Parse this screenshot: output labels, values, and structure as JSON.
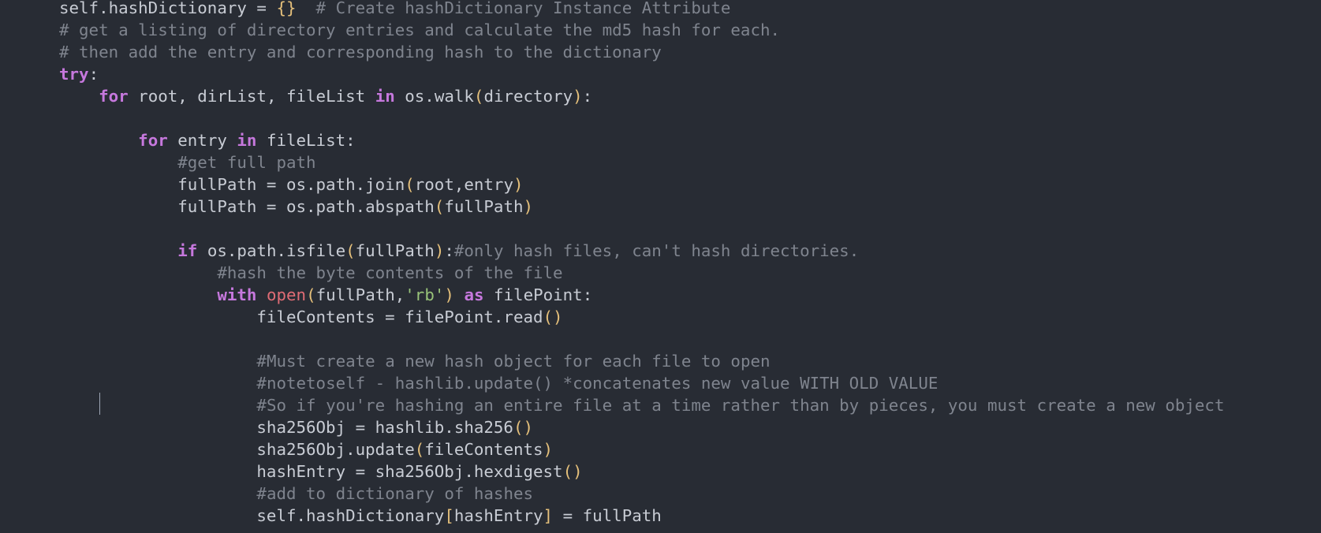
{
  "editor": {
    "lines": [
      [
        {
          "t": "self.hashDictionary = ",
          "c": "tx"
        },
        {
          "t": "{}",
          "c": "br"
        },
        {
          "t": "  # Create hashDictionary Instance Attribute",
          "c": "cm"
        }
      ],
      [
        {
          "t": "# get a listing of directory entries and calculate the md5 hash for each.",
          "c": "cm"
        }
      ],
      [
        {
          "t": "# then add the entry and corresponding hash to the dictionary",
          "c": "cm"
        }
      ],
      [
        {
          "t": "try",
          "c": "kw"
        },
        {
          "t": ":",
          "c": "tx"
        }
      ],
      [
        {
          "t": "    ",
          "c": "tx"
        },
        {
          "t": "for",
          "c": "kw"
        },
        {
          "t": " root, dirList, fileList ",
          "c": "tx"
        },
        {
          "t": "in",
          "c": "kw"
        },
        {
          "t": " os.walk",
          "c": "tx"
        },
        {
          "t": "(",
          "c": "br"
        },
        {
          "t": "directory",
          "c": "tx"
        },
        {
          "t": ")",
          "c": "br"
        },
        {
          "t": ":",
          "c": "tx"
        }
      ],
      [
        {
          "t": "",
          "c": "tx"
        }
      ],
      [
        {
          "t": "        ",
          "c": "tx"
        },
        {
          "t": "for",
          "c": "kw"
        },
        {
          "t": " entry ",
          "c": "tx"
        },
        {
          "t": "in",
          "c": "kw"
        },
        {
          "t": " fileList:",
          "c": "tx"
        }
      ],
      [
        {
          "t": "            ",
          "c": "tx"
        },
        {
          "t": "#get full path",
          "c": "cm"
        }
      ],
      [
        {
          "t": "            fullPath = os.path.join",
          "c": "tx"
        },
        {
          "t": "(",
          "c": "br"
        },
        {
          "t": "root,entry",
          "c": "tx"
        },
        {
          "t": ")",
          "c": "br"
        }
      ],
      [
        {
          "t": "            fullPath = os.path.abspath",
          "c": "tx"
        },
        {
          "t": "(",
          "c": "br"
        },
        {
          "t": "fullPath",
          "c": "tx"
        },
        {
          "t": ")",
          "c": "br"
        }
      ],
      [
        {
          "t": "",
          "c": "tx"
        }
      ],
      [
        {
          "t": "            ",
          "c": "tx"
        },
        {
          "t": "if",
          "c": "kw"
        },
        {
          "t": " os.path.isfile",
          "c": "tx"
        },
        {
          "t": "(",
          "c": "br"
        },
        {
          "t": "fullPath",
          "c": "tx"
        },
        {
          "t": ")",
          "c": "br"
        },
        {
          "t": ":",
          "c": "tx"
        },
        {
          "t": "#only hash files, can't hash directories.",
          "c": "cm"
        }
      ],
      [
        {
          "t": "                ",
          "c": "tx"
        },
        {
          "t": "#hash the byte contents of the file",
          "c": "cm"
        }
      ],
      [
        {
          "t": "                ",
          "c": "tx"
        },
        {
          "t": "with",
          "c": "kw"
        },
        {
          "t": " ",
          "c": "tx"
        },
        {
          "t": "open",
          "c": "bi"
        },
        {
          "t": "(",
          "c": "br"
        },
        {
          "t": "fullPath,",
          "c": "tx"
        },
        {
          "t": "'rb'",
          "c": "str"
        },
        {
          "t": ")",
          "c": "br"
        },
        {
          "t": " ",
          "c": "tx"
        },
        {
          "t": "as",
          "c": "kw"
        },
        {
          "t": " filePoint:",
          "c": "tx"
        }
      ],
      [
        {
          "t": "                    fileContents = filePoint.read",
          "c": "tx"
        },
        {
          "t": "()",
          "c": "br"
        }
      ],
      [
        {
          "t": "",
          "c": "tx"
        }
      ],
      [
        {
          "t": "                    ",
          "c": "tx"
        },
        {
          "t": "#Must create a new hash object for each file to open",
          "c": "cm"
        }
      ],
      [
        {
          "t": "                    ",
          "c": "tx"
        },
        {
          "t": "#notetoself - hashlib.update() *concatenates new value WITH OLD VALUE",
          "c": "cm"
        }
      ],
      [
        {
          "t": "                    ",
          "c": "tx"
        },
        {
          "t": "#So if you're hashing an entire file at a time rather than by pieces, you must create a new object",
          "c": "cm"
        }
      ],
      [
        {
          "t": "                    sha256Obj = hashlib.sha256",
          "c": "tx"
        },
        {
          "t": "()",
          "c": "br"
        }
      ],
      [
        {
          "t": "                    sha256Obj.update",
          "c": "tx"
        },
        {
          "t": "(",
          "c": "br"
        },
        {
          "t": "fileContents",
          "c": "tx"
        },
        {
          "t": ")",
          "c": "br"
        }
      ],
      [
        {
          "t": "                    hashEntry = sha256Obj.hexdigest",
          "c": "tx"
        },
        {
          "t": "()",
          "c": "br"
        }
      ],
      [
        {
          "t": "                    ",
          "c": "tx"
        },
        {
          "t": "#add to dictionary of hashes",
          "c": "cm"
        }
      ],
      [
        {
          "t": "                    self.hashDictionary",
          "c": "tx"
        },
        {
          "t": "[",
          "c": "br"
        },
        {
          "t": "hashEntry",
          "c": "tx"
        },
        {
          "t": "]",
          "c": "br"
        },
        {
          "t": " = fullPath",
          "c": "tx"
        }
      ]
    ]
  }
}
